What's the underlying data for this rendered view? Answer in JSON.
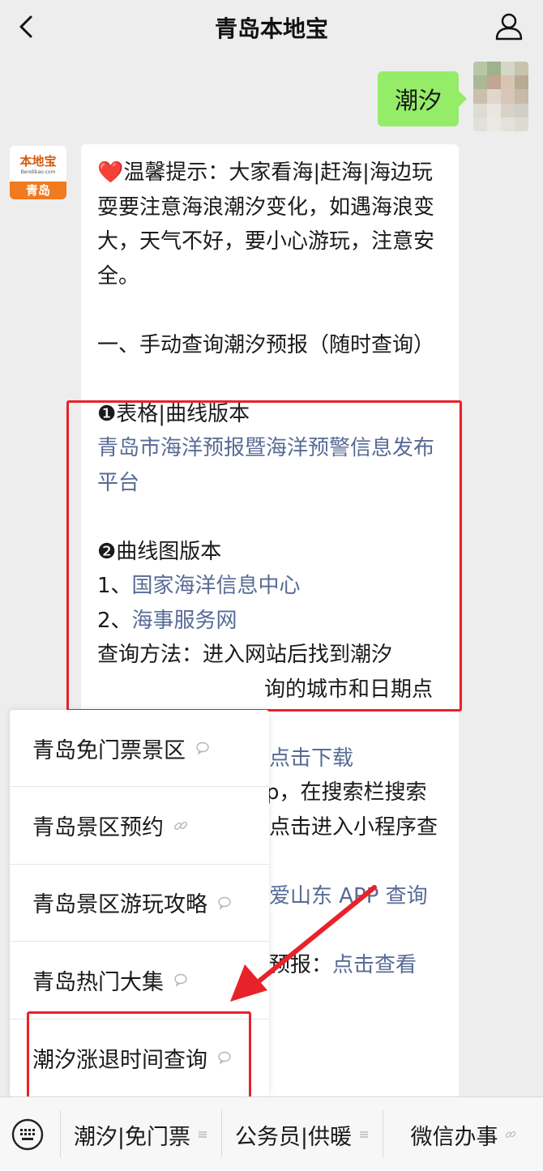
{
  "header": {
    "title": "青岛本地宝"
  },
  "chat": {
    "outgoing": {
      "text": "潮汐"
    },
    "bot_avatar": {
      "brand": "本地宝",
      "url": "Bendibao.com",
      "city": "青岛"
    },
    "reply": {
      "heart": "❤️",
      "tip": "温馨提示：大家看海|赶海|海边玩耍要注意海浪潮汐变化，如遇海浪变大，天气不好，要小心游玩，注意安全。",
      "section1": "一、手动查询潮汐预报（随时查询）",
      "item1_title": "❶表格|曲线版本",
      "item1_link": "青岛市海洋预报暨海洋预警信息发布平台",
      "item2_title": "❷曲线图版本",
      "item2_line1_prefix": "1、",
      "item2_line1_link": "国家海洋信息中心",
      "item2_line2_prefix": "2、",
      "item2_line2_link": "海事服务网",
      "method_line1": "查询方法：进入网站后找到潮汐",
      "method_line2": "询的城市和日期点",
      "download_link": "点击下载",
      "app_line1": "p，在搜索栏搜索",
      "app_line2": "点击进入小程序查",
      "app_link": "爱山东 APP 查询",
      "forecast_prefix": "预报：",
      "forecast_link": "点击查看"
    }
  },
  "menu": {
    "items": [
      {
        "label": "青岛免门票景区",
        "icon": "chat-bubble-icon"
      },
      {
        "label": "青岛景区预约",
        "icon": "link-icon"
      },
      {
        "label": "青岛景区游玩攻略",
        "icon": "chat-bubble-icon"
      },
      {
        "label": "青岛热门大集",
        "icon": "chat-bubble-icon"
      },
      {
        "label": "潮汐涨退时间查询",
        "icon": "chat-bubble-icon"
      }
    ]
  },
  "bottom": {
    "tabs": [
      {
        "label": "潮汐|免门票",
        "icon": "menu-lines-icon"
      },
      {
        "label": "公务员|供暖",
        "icon": "menu-lines-icon"
      },
      {
        "label": "微信办事",
        "icon": "link-icon"
      }
    ]
  },
  "colors": {
    "link": "#576b95",
    "highlight": "#e8222a",
    "outgoing_bubble": "#95ec69",
    "brand_orange": "#f07a1f"
  }
}
